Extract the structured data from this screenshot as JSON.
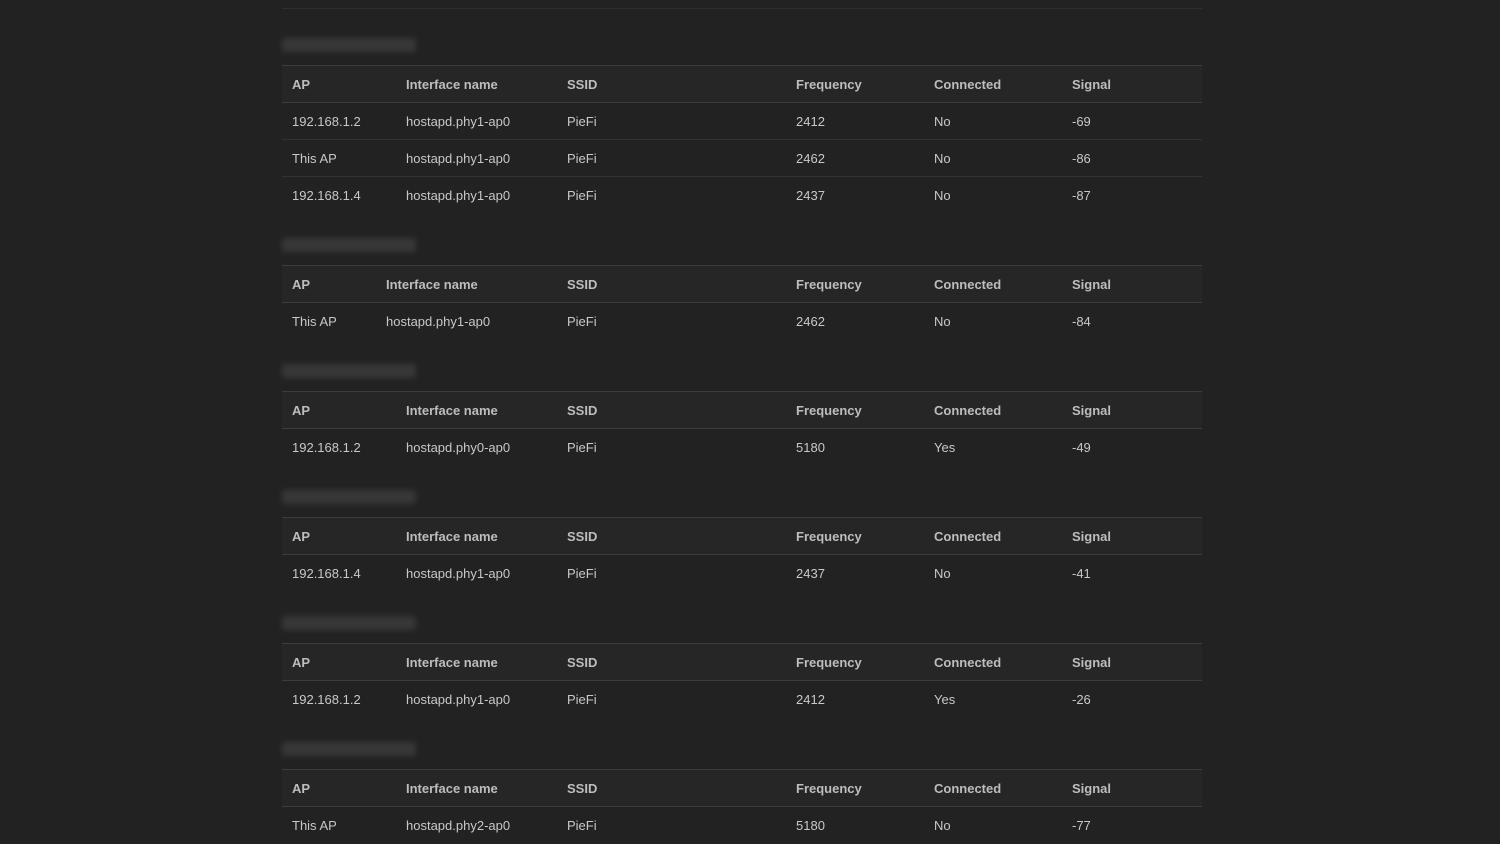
{
  "columns": {
    "ap": "AP",
    "interface": "Interface name",
    "ssid": "SSID",
    "frequency": "Frequency",
    "connected": "Connected",
    "signal": "Signal"
  },
  "sections": [
    {
      "rows": [
        {
          "ap": "192.168.1.2",
          "interface": "hostapd.phy1-ap0",
          "ssid": "PieFi",
          "frequency": "2412",
          "connected": "No",
          "signal": "-69"
        },
        {
          "ap": "This AP",
          "interface": "hostapd.phy1-ap0",
          "ssid": "PieFi",
          "frequency": "2462",
          "connected": "No",
          "signal": "-86"
        },
        {
          "ap": "192.168.1.4",
          "interface": "hostapd.phy1-ap0",
          "ssid": "PieFi",
          "frequency": "2437",
          "connected": "No",
          "signal": "-87"
        }
      ]
    },
    {
      "rows": [
        {
          "ap": "This AP",
          "interface": "hostapd.phy1-ap0",
          "ssid": "PieFi",
          "frequency": "2462",
          "connected": "No",
          "signal": "-84"
        }
      ]
    },
    {
      "rows": [
        {
          "ap": "192.168.1.2",
          "interface": "hostapd.phy0-ap0",
          "ssid": "PieFi",
          "frequency": "5180",
          "connected": "Yes",
          "signal": "-49"
        }
      ]
    },
    {
      "rows": [
        {
          "ap": "192.168.1.4",
          "interface": "hostapd.phy1-ap0",
          "ssid": "PieFi",
          "frequency": "2437",
          "connected": "No",
          "signal": "-41"
        }
      ]
    },
    {
      "rows": [
        {
          "ap": "192.168.1.2",
          "interface": "hostapd.phy1-ap0",
          "ssid": "PieFi",
          "frequency": "2412",
          "connected": "Yes",
          "signal": "-26"
        }
      ]
    },
    {
      "rows": [
        {
          "ap": "This AP",
          "interface": "hostapd.phy2-ap0",
          "ssid": "PieFi",
          "frequency": "5180",
          "connected": "No",
          "signal": "-77"
        }
      ]
    }
  ]
}
